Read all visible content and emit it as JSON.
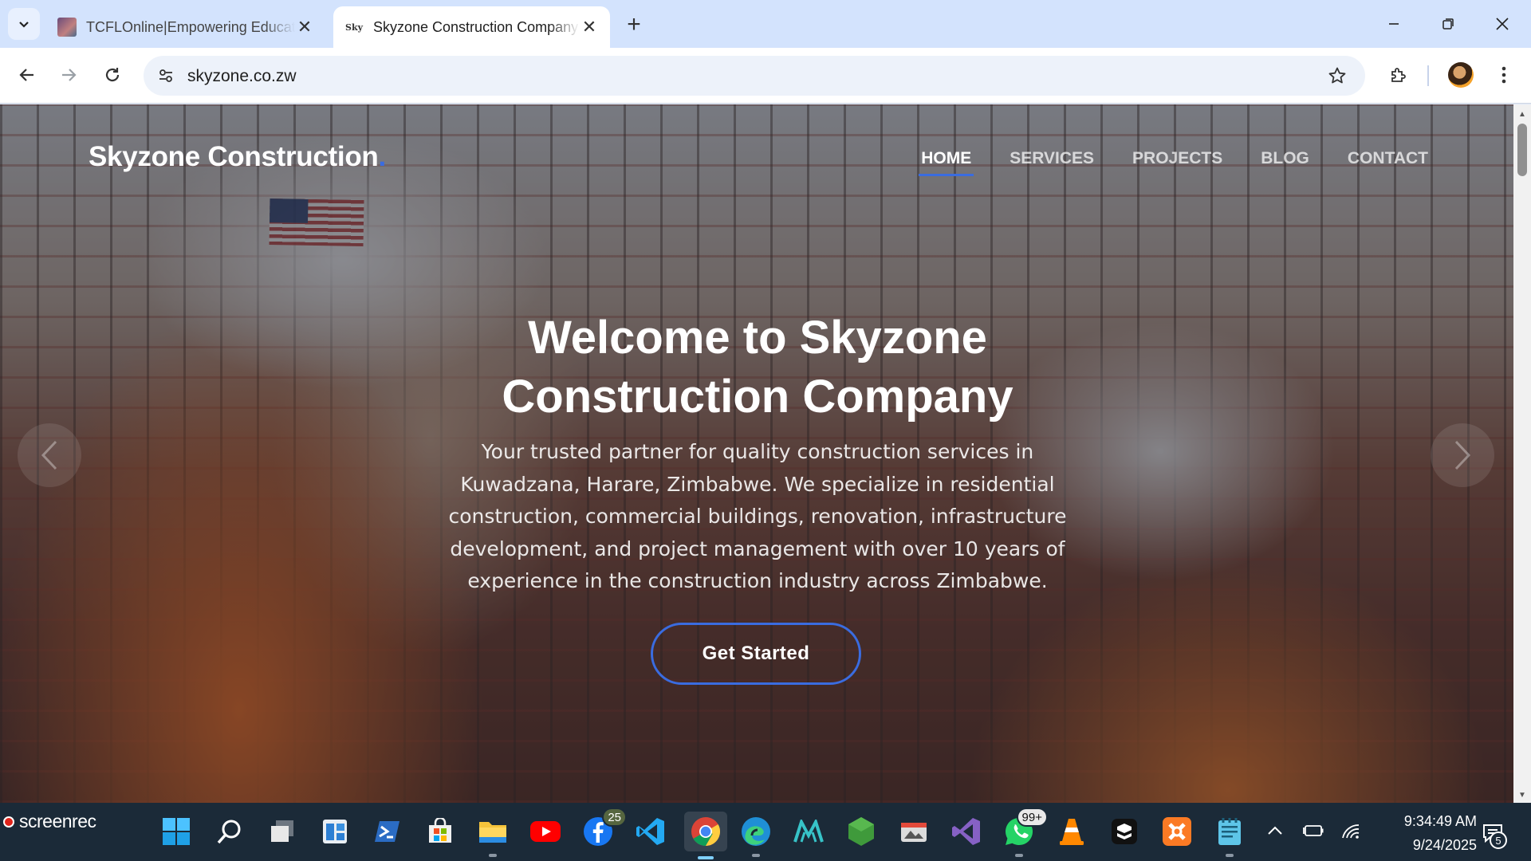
{
  "browser": {
    "tabs": [
      {
        "title": "TCFLOnline|Empowering Educat",
        "active": false
      },
      {
        "title": "Skyzone Construction Company",
        "active": true
      }
    ],
    "url": "skyzone.co.zw",
    "icons": {
      "tab_search": "chevron-down-icon",
      "tab_close": "close-icon",
      "new_tab": "plus-icon",
      "back": "arrow-left-icon",
      "forward": "arrow-right-icon",
      "reload": "reload-icon",
      "site_info": "tune-icon",
      "bookmark": "star-icon",
      "extensions": "puzzle-icon",
      "menu": "kebab-menu-icon"
    }
  },
  "site": {
    "brand": "Skyzone Construction",
    "brand_dot": ".",
    "nav": [
      {
        "label": "HOME",
        "active": true
      },
      {
        "label": "SERVICES",
        "active": false
      },
      {
        "label": "PROJECTS",
        "active": false
      },
      {
        "label": "BLOG",
        "active": false
      },
      {
        "label": "CONTACT",
        "active": false
      }
    ],
    "hero": {
      "title_line1": "Welcome to Skyzone",
      "title_line2": "Construction Company",
      "subtitle": "Your trusted partner for quality construction services in Kuwadzana, Harare, Zimbabwe. We specialize in residential construction, commercial buildings, renovation, infrastructure development, and project management with over 10 years of experience in the construction industry across Zimbabwe.",
      "cta": "Get Started"
    },
    "accent_color": "#3a6ce0"
  },
  "taskbar": {
    "screenrec_label": "screenrec",
    "apps": [
      {
        "name": "windows-start-icon"
      },
      {
        "name": "search-icon"
      },
      {
        "name": "task-view-icon"
      },
      {
        "name": "widgets-icon"
      },
      {
        "name": "powershell-icon"
      },
      {
        "name": "microsoft-store-icon"
      },
      {
        "name": "file-explorer-icon"
      },
      {
        "name": "youtube-icon"
      },
      {
        "name": "facebook-icon",
        "badge": "25"
      },
      {
        "name": "vscode-icon"
      },
      {
        "name": "chrome-icon"
      },
      {
        "name": "edge-icon"
      },
      {
        "name": "maya-icon"
      },
      {
        "name": "node-js-icon"
      },
      {
        "name": "photo-viewer-icon"
      },
      {
        "name": "visual-studio-icon"
      },
      {
        "name": "whatsapp-icon",
        "badge": "99+"
      },
      {
        "name": "vlc-icon"
      },
      {
        "name": "capcut-icon"
      },
      {
        "name": "xampp-icon"
      },
      {
        "name": "notepad-icon"
      }
    ],
    "time": "9:34:49 AM",
    "date": "9/24/2025",
    "notification_count": "5"
  }
}
